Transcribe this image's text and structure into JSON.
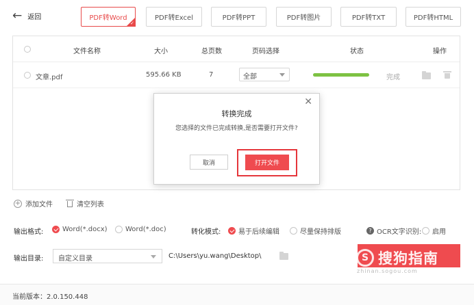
{
  "back": {
    "label": "返回"
  },
  "tabs": [
    {
      "label": "PDF转Word",
      "active": true
    },
    {
      "label": "PDF转Excel",
      "active": false
    },
    {
      "label": "PDF转PPT",
      "active": false
    },
    {
      "label": "PDF转图片",
      "active": false
    },
    {
      "label": "PDF转TXT",
      "active": false
    },
    {
      "label": "PDF转HTML",
      "active": false
    }
  ],
  "table": {
    "columns": [
      "文件名称",
      "大小",
      "总页数",
      "页码选择",
      "状态",
      "操作"
    ],
    "rows": [
      {
        "name": "文章.pdf",
        "size": "595.66 KB",
        "pages": "7",
        "page_select": "全部",
        "progress": 1.0,
        "status": "完成"
      }
    ]
  },
  "dialog": {
    "title": "转换完成",
    "message": "您选择的文件已完成转换,是否需要打开文件?",
    "cancel": "取消",
    "open": "打开文件",
    "close_icon": "close-icon"
  },
  "actions": {
    "add_file": "添加文件",
    "clear_list": "清空列表"
  },
  "output": {
    "format_label": "输出格式:",
    "format_docx": "Word(*.docx)",
    "format_doc": "Word(*.doc)",
    "mode_label": "转化模式:",
    "mode_edit": "易于后续编辑",
    "mode_layout": "尽量保持排版",
    "ocr_label": "OCR文字识别:",
    "ocr_enable": "启用",
    "dir_label": "输出目录:",
    "dir_select": "自定义目录",
    "dir_path": "C:\\Users\\yu.wang\\Desktop\\"
  },
  "watermark": {
    "glyph": "S",
    "text": "搜狗指南",
    "url": "zhinan.sogou.com"
  },
  "footer": {
    "version": "当前版本：2.0.150.448"
  },
  "colors": {
    "accent": "#ef4b4f",
    "progress": "#7dc243"
  }
}
